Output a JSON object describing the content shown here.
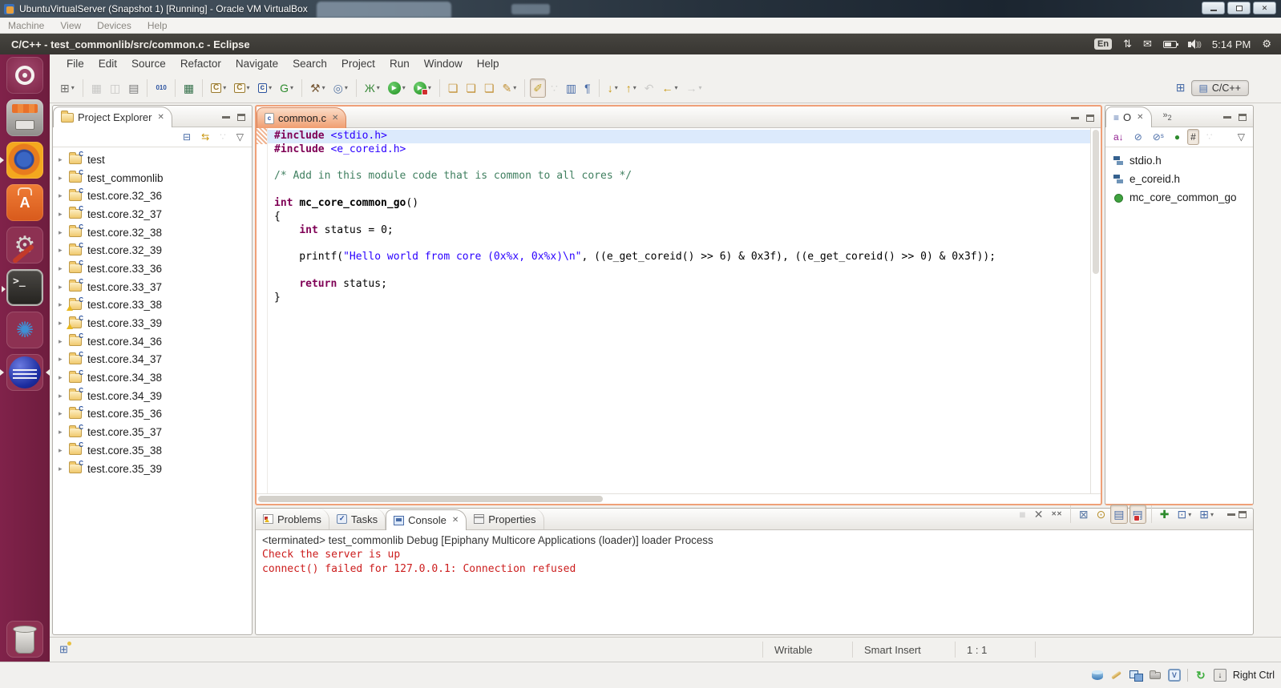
{
  "glyphs": {
    "close_tab": "✕",
    "dropdown": "▾",
    "twisty": "▸",
    "view_menu": "▽",
    "more_views_chevron": "»",
    "open_perspective": "⊞",
    "perspective_icon": "▤",
    "outline_tab_icon": "≡",
    "fastview_icon": "⊞",
    "window_close": "✕"
  },
  "vbox": {
    "window_title": "UbuntuVirtualServer (Snapshot 1) [Running] - Oracle VM VirtualBox",
    "menu_items": [
      "Machine",
      "View",
      "Devices",
      "Help"
    ],
    "host_key": "Right Ctrl",
    "status_icons": [
      {
        "n": "hard-disks-icon",
        "kind": "vs-disk"
      },
      {
        "n": "mouse-pen-icon",
        "kind": "vs-pen"
      },
      {
        "n": "network-adapters-icon",
        "kind": "vs-net"
      },
      {
        "n": "shared-folders-icon",
        "kind": "vs-folder"
      },
      {
        "n": "vm-features-icon",
        "kind": "vs-chip",
        "g": "V"
      },
      {
        "n": "statusbar-separator",
        "kind": "vs-sep"
      },
      {
        "n": "mouse-integration-icon",
        "kind": "vs-swirl",
        "g": "↻"
      },
      {
        "n": "host-key-indicator-icon",
        "kind": "vs-hostkey",
        "g": "↓"
      }
    ]
  },
  "panel": {
    "app_title": "C/C++ - test_commonlib/src/common.c - Eclipse",
    "keyboard_layout": "En",
    "net_glyph": "⇅",
    "mail_glyph": "✉",
    "clock": "5:14 PM",
    "gear_glyph": "⚙"
  },
  "launcher": {
    "items": [
      {
        "n": "launcher-dash",
        "kind": "tl-dash"
      },
      {
        "n": "launcher-files",
        "kind": "tl-files"
      },
      {
        "n": "launcher-firefox",
        "kind": "tl-firefox",
        "running": true
      },
      {
        "n": "launcher-software-center",
        "kind": "tl-software",
        "g": "A"
      },
      {
        "n": "launcher-system-settings",
        "kind": "tl-settings",
        "g": "⚙"
      },
      {
        "n": "launcher-terminal",
        "kind": "tl-terminal",
        "g": ">_",
        "running": true
      },
      {
        "n": "launcher-blue-app",
        "kind": "tl-pinwheel",
        "g": "✺"
      },
      {
        "n": "launcher-eclipse",
        "kind": "tl-eclipse",
        "running": true,
        "focused": true
      }
    ],
    "trash": {
      "n": "launcher-trash",
      "kind": "tl-trash"
    }
  },
  "eclipse": {
    "menu_items": [
      "File",
      "Edit",
      "Source",
      "Refactor",
      "Navigate",
      "Search",
      "Project",
      "Run",
      "Window",
      "Help"
    ],
    "toolbar": {
      "items": [
        {
          "n": "new-wizard",
          "g": "⊞",
          "c": "#6d6d6a",
          "drop": true
        },
        {
          "sep": true
        },
        {
          "n": "save",
          "g": "▦",
          "c": "#777777",
          "dis": true
        },
        {
          "n": "save-all",
          "g": "◫",
          "c": "#777777",
          "dis": true
        },
        {
          "n": "print",
          "g": "▤",
          "c": "#777777"
        },
        {
          "sep": true
        },
        {
          "n": "binary-file",
          "g": "010",
          "c": "#2a52a0",
          "cls": "tiny"
        },
        {
          "sep": true
        },
        {
          "n": "build-all",
          "g": "▦",
          "c": "#34704a"
        },
        {
          "sep": true
        },
        {
          "n": "new-c-source-folder",
          "g": "C",
          "c": "#9a7b2f",
          "cls": "boxed",
          "drop": true
        },
        {
          "n": "new-c-project",
          "g": "C",
          "c": "#9a7b2f",
          "cls": "boxed",
          "drop": true
        },
        {
          "n": "new-c-file",
          "g": "c",
          "c": "#2a52a0",
          "cls": "boxed",
          "drop": true
        },
        {
          "n": "new-class",
          "g": "G",
          "c": "#2e8b2e",
          "drop": true
        },
        {
          "sep": true
        },
        {
          "n": "build",
          "g": "⚒",
          "c": "#7a5c3a",
          "drop": true
        },
        {
          "n": "build-configurations",
          "g": "◎",
          "c": "#5b7aa6",
          "drop": true
        },
        {
          "sep": true
        },
        {
          "n": "debug",
          "g": "Ж",
          "c": "#3c8a3c",
          "drop": true
        },
        {
          "n": "run",
          "g": "▶",
          "c": "#ffffff",
          "cls": "runbtn",
          "drop": true
        },
        {
          "n": "run-external-tools",
          "g": "▶",
          "c": "#ffffff",
          "cls": "runbtn redbadge",
          "drop": true
        },
        {
          "sep": true
        },
        {
          "n": "open-element-1",
          "g": "❏",
          "c": "#c29136"
        },
        {
          "n": "open-element-2",
          "g": "❏",
          "c": "#c29136"
        },
        {
          "n": "open-element-3",
          "g": "❏",
          "c": "#c29136"
        },
        {
          "n": "search-marker-pen",
          "g": "✎",
          "c": "#c29136",
          "drop": true
        },
        {
          "sep": true
        },
        {
          "n": "toggle-mark-occurrences",
          "g": "✐",
          "c": "#c2a22c",
          "pressed": true
        },
        {
          "n": "occurrences-secondary",
          "g": "∵",
          "c": "#999999",
          "dis": true
        },
        {
          "n": "block-selection-mode",
          "g": "▥",
          "c": "#4a6da8"
        },
        {
          "n": "show-whitespace",
          "g": "¶",
          "c": "#4a6da8"
        },
        {
          "sep": true
        },
        {
          "n": "next-annotation",
          "g": "↓",
          "c": "#c8960c",
          "drop": true
        },
        {
          "n": "previous-annotation",
          "g": "↑",
          "c": "#c8960c",
          "drop": true
        },
        {
          "n": "last-edit-location",
          "g": "↶",
          "c": "#888888",
          "dis": true
        },
        {
          "n": "back-history",
          "g": "←",
          "c": "#c8960c",
          "drop": true
        },
        {
          "n": "forward-history",
          "g": "→",
          "c": "#888888",
          "dis": true,
          "drop": true
        }
      ]
    },
    "perspective": {
      "label": "C/C++"
    },
    "project_explorer": {
      "title": "Project Explorer",
      "toolbar": [
        {
          "n": "collapse-all",
          "g": "⊟",
          "c": "#4a6da8"
        },
        {
          "n": "link-with-editor",
          "g": "⇆",
          "c": "#c8960c"
        },
        {
          "n": "focus-extra",
          "g": "∵",
          "c": "#999999",
          "dis": true
        },
        {
          "n": "view-menu",
          "g": "▽",
          "c": "#555555"
        }
      ],
      "folder_badge": "C",
      "items": [
        {
          "label": "test"
        },
        {
          "label": "test_commonlib"
        },
        {
          "label": "test.core.32_36"
        },
        {
          "label": "test.core.32_37"
        },
        {
          "label": "test.core.32_38"
        },
        {
          "label": "test.core.32_39"
        },
        {
          "label": "test.core.33_36"
        },
        {
          "label": "test.core.33_37"
        },
        {
          "label": "test.core.33_38",
          "warning": true
        },
        {
          "label": "test.core.33_39",
          "warning": true
        },
        {
          "label": "test.core.34_36"
        },
        {
          "label": "test.core.34_37"
        },
        {
          "label": "test.core.34_38"
        },
        {
          "label": "test.core.34_39"
        },
        {
          "label": "test.core.35_36"
        },
        {
          "label": "test.core.35_37"
        },
        {
          "label": "test.core.35_38"
        },
        {
          "label": "test.core.35_39"
        }
      ]
    },
    "editor": {
      "tab_label": "common.c",
      "file_icon_letter": "c",
      "lines": [
        {
          "hl": true,
          "s": [
            {
              "t": "#include",
              "c": "kw"
            },
            {
              "t": " "
            },
            {
              "t": "<stdio.h>",
              "c": "str"
            }
          ]
        },
        {
          "s": [
            {
              "t": "#include",
              "c": "kw"
            },
            {
              "t": " "
            },
            {
              "t": "<e_coreid.h>",
              "c": "str"
            }
          ]
        },
        {
          "s": []
        },
        {
          "s": [
            {
              "t": "/* Add in this module code that is common to all cores */",
              "c": "com"
            }
          ]
        },
        {
          "s": []
        },
        {
          "s": [
            {
              "t": "int",
              "c": "kw"
            },
            {
              "t": " "
            },
            {
              "t": "mc_core_common_go",
              "c": "fn"
            },
            {
              "t": "()"
            }
          ]
        },
        {
          "s": [
            {
              "t": "{"
            }
          ]
        },
        {
          "s": [
            {
              "t": "    "
            },
            {
              "t": "int",
              "c": "kw"
            },
            {
              "t": " status = 0;"
            }
          ]
        },
        {
          "s": []
        },
        {
          "s": [
            {
              "t": "    printf("
            },
            {
              "t": "\"Hello world from core (0x%x, 0x%x)\\n\"",
              "c": "str"
            },
            {
              "t": ", ((e_get_coreid() >> 6) & 0x3f), ((e_get_coreid() >> 0) & 0x3f));"
            }
          ]
        },
        {
          "s": []
        },
        {
          "s": [
            {
              "t": "    "
            },
            {
              "t": "return",
              "c": "kw"
            },
            {
              "t": " status;"
            }
          ]
        },
        {
          "s": [
            {
              "t": "}"
            }
          ]
        }
      ]
    },
    "outline": {
      "tab_label": "O",
      "more_count": "2",
      "toolbar": [
        {
          "n": "sort-alphabetically",
          "g": "a↓",
          "c": "#902090"
        },
        {
          "n": "hide-fields",
          "g": "⊘",
          "c": "#4a6da8"
        },
        {
          "n": "hide-static-members",
          "g": "⊘ˢ",
          "c": "#4a6da8"
        },
        {
          "n": "hide-non-public-members",
          "g": "●",
          "c": "#2e8b2e"
        },
        {
          "n": "link-with-editor",
          "g": "#",
          "c": "#333333",
          "pressed": true
        },
        {
          "n": "outline-extra",
          "g": "∵",
          "c": "#999999",
          "dis": true
        },
        {
          "n": "view-menu",
          "g": "▽",
          "c": "#555555",
          "cls": "push-right"
        }
      ],
      "items": [
        {
          "label": "stdio.h",
          "kind": "include"
        },
        {
          "label": "e_coreid.h",
          "kind": "include"
        },
        {
          "label": "mc_core_common_go",
          "kind": "function"
        }
      ]
    },
    "console": {
      "tabs": [
        {
          "label": "Problems",
          "icon": "ti-problems"
        },
        {
          "label": "Tasks",
          "icon": "ti-tasks"
        },
        {
          "label": "Console",
          "icon": "ti-console",
          "active": true
        },
        {
          "label": "Properties",
          "icon": "ti-properties"
        }
      ],
      "toolbar": [
        {
          "n": "terminate",
          "g": "■",
          "c": "#a8a8a8",
          "dis": true
        },
        {
          "n": "remove-launch",
          "g": "✕",
          "c": "#6e6e6e"
        },
        {
          "n": "remove-all-terminated",
          "g": "✕✕",
          "c": "#6e6e6e",
          "cls": "tiny"
        },
        {
          "sep": true
        },
        {
          "n": "clear-console",
          "g": "⊠",
          "c": "#5b7aa6"
        },
        {
          "n": "scroll-lock",
          "g": "⊙",
          "c": "#b8912f"
        },
        {
          "n": "show-console-on-stdout",
          "g": "▤",
          "c": "#4a6da8",
          "pressed": true
        },
        {
          "n": "show-console-on-stderr",
          "g": "▤",
          "c": "#4a6da8",
          "pressed": true,
          "cls": "redbadge"
        },
        {
          "sep": true
        },
        {
          "n": "pin-console",
          "g": "✚",
          "c": "#2e8b2e"
        },
        {
          "n": "display-selected-console",
          "g": "⊡",
          "c": "#4a6da8",
          "drop": true
        },
        {
          "n": "open-console",
          "g": "⊞",
          "c": "#4a6da8",
          "drop": true
        }
      ],
      "header": "<terminated> test_commonlib Debug [Epiphany Multicore Applications (loader)] loader Process",
      "lines": [
        "Check the server is up",
        "connect() failed for 127.0.0.1: Connection refused"
      ]
    },
    "status": {
      "writable": "Writable",
      "insert_mode": "Smart Insert",
      "position": "1 : 1"
    }
  }
}
